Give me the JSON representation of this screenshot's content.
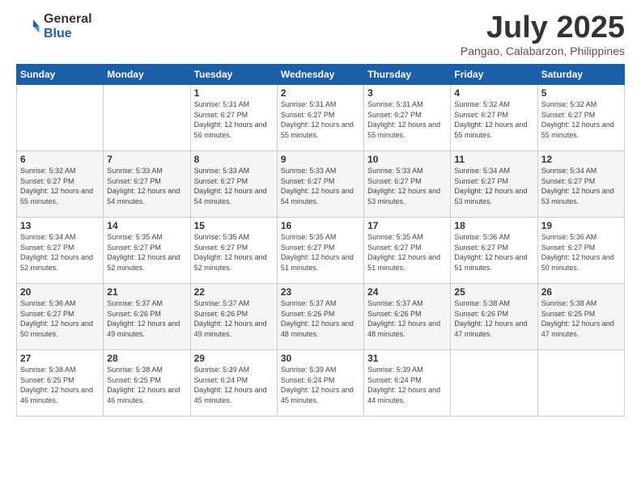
{
  "header": {
    "logo_general": "General",
    "logo_blue": "Blue",
    "month_title": "July 2025",
    "location": "Pangao, Calabarzon, Philippines"
  },
  "days_of_week": [
    "Sunday",
    "Monday",
    "Tuesday",
    "Wednesday",
    "Thursday",
    "Friday",
    "Saturday"
  ],
  "weeks": [
    [
      {
        "day": "",
        "info": ""
      },
      {
        "day": "",
        "info": ""
      },
      {
        "day": "1",
        "info": "Sunrise: 5:31 AM\nSunset: 6:27 PM\nDaylight: 12 hours and 56 minutes."
      },
      {
        "day": "2",
        "info": "Sunrise: 5:31 AM\nSunset: 6:27 PM\nDaylight: 12 hours and 55 minutes."
      },
      {
        "day": "3",
        "info": "Sunrise: 5:31 AM\nSunset: 6:27 PM\nDaylight: 12 hours and 55 minutes."
      },
      {
        "day": "4",
        "info": "Sunrise: 5:32 AM\nSunset: 6:27 PM\nDaylight: 12 hours and 55 minutes."
      },
      {
        "day": "5",
        "info": "Sunrise: 5:32 AM\nSunset: 6:27 PM\nDaylight: 12 hours and 55 minutes."
      }
    ],
    [
      {
        "day": "6",
        "info": "Sunrise: 5:32 AM\nSunset: 6:27 PM\nDaylight: 12 hours and 55 minutes."
      },
      {
        "day": "7",
        "info": "Sunrise: 5:33 AM\nSunset: 6:27 PM\nDaylight: 12 hours and 54 minutes."
      },
      {
        "day": "8",
        "info": "Sunrise: 5:33 AM\nSunset: 6:27 PM\nDaylight: 12 hours and 54 minutes."
      },
      {
        "day": "9",
        "info": "Sunrise: 5:33 AM\nSunset: 6:27 PM\nDaylight: 12 hours and 54 minutes."
      },
      {
        "day": "10",
        "info": "Sunrise: 5:33 AM\nSunset: 6:27 PM\nDaylight: 12 hours and 53 minutes."
      },
      {
        "day": "11",
        "info": "Sunrise: 5:34 AM\nSunset: 6:27 PM\nDaylight: 12 hours and 53 minutes."
      },
      {
        "day": "12",
        "info": "Sunrise: 5:34 AM\nSunset: 6:27 PM\nDaylight: 12 hours and 53 minutes."
      }
    ],
    [
      {
        "day": "13",
        "info": "Sunrise: 5:34 AM\nSunset: 6:27 PM\nDaylight: 12 hours and 52 minutes."
      },
      {
        "day": "14",
        "info": "Sunrise: 5:35 AM\nSunset: 6:27 PM\nDaylight: 12 hours and 52 minutes."
      },
      {
        "day": "15",
        "info": "Sunrise: 5:35 AM\nSunset: 6:27 PM\nDaylight: 12 hours and 52 minutes."
      },
      {
        "day": "16",
        "info": "Sunrise: 5:35 AM\nSunset: 6:27 PM\nDaylight: 12 hours and 51 minutes."
      },
      {
        "day": "17",
        "info": "Sunrise: 5:35 AM\nSunset: 6:27 PM\nDaylight: 12 hours and 51 minutes."
      },
      {
        "day": "18",
        "info": "Sunrise: 5:36 AM\nSunset: 6:27 PM\nDaylight: 12 hours and 51 minutes."
      },
      {
        "day": "19",
        "info": "Sunrise: 5:36 AM\nSunset: 6:27 PM\nDaylight: 12 hours and 50 minutes."
      }
    ],
    [
      {
        "day": "20",
        "info": "Sunrise: 5:36 AM\nSunset: 6:27 PM\nDaylight: 12 hours and 50 minutes."
      },
      {
        "day": "21",
        "info": "Sunrise: 5:37 AM\nSunset: 6:26 PM\nDaylight: 12 hours and 49 minutes."
      },
      {
        "day": "22",
        "info": "Sunrise: 5:37 AM\nSunset: 6:26 PM\nDaylight: 12 hours and 49 minutes."
      },
      {
        "day": "23",
        "info": "Sunrise: 5:37 AM\nSunset: 6:26 PM\nDaylight: 12 hours and 48 minutes."
      },
      {
        "day": "24",
        "info": "Sunrise: 5:37 AM\nSunset: 6:26 PM\nDaylight: 12 hours and 48 minutes."
      },
      {
        "day": "25",
        "info": "Sunrise: 5:38 AM\nSunset: 6:26 PM\nDaylight: 12 hours and 47 minutes."
      },
      {
        "day": "26",
        "info": "Sunrise: 5:38 AM\nSunset: 6:25 PM\nDaylight: 12 hours and 47 minutes."
      }
    ],
    [
      {
        "day": "27",
        "info": "Sunrise: 5:38 AM\nSunset: 6:25 PM\nDaylight: 12 hours and 46 minutes."
      },
      {
        "day": "28",
        "info": "Sunrise: 5:38 AM\nSunset: 6:25 PM\nDaylight: 12 hours and 46 minutes."
      },
      {
        "day": "29",
        "info": "Sunrise: 5:39 AM\nSunset: 6:24 PM\nDaylight: 12 hours and 45 minutes."
      },
      {
        "day": "30",
        "info": "Sunrise: 5:39 AM\nSunset: 6:24 PM\nDaylight: 12 hours and 45 minutes."
      },
      {
        "day": "31",
        "info": "Sunrise: 5:39 AM\nSunset: 6:24 PM\nDaylight: 12 hours and 44 minutes."
      },
      {
        "day": "",
        "info": ""
      },
      {
        "day": "",
        "info": ""
      }
    ]
  ]
}
